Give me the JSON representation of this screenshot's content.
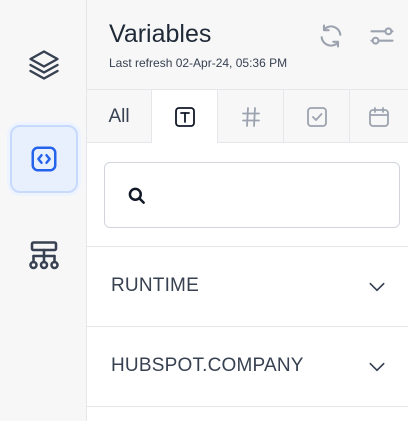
{
  "sidebar": {
    "items": [
      {
        "icon": "layers-icon",
        "active": false
      },
      {
        "icon": "code-brackets-icon",
        "active": true
      },
      {
        "icon": "flow-tree-icon",
        "active": false
      }
    ]
  },
  "header": {
    "title": "Variables",
    "subtitle": "Last refresh 02-Apr-24, 05:36 PM",
    "icons": [
      "refresh-icon",
      "filter-sliders-icon"
    ]
  },
  "tabs": {
    "all_label": "All",
    "items": [
      "text-type-icon",
      "number-hash-icon",
      "checkbox-icon",
      "calendar-icon"
    ],
    "active_index": 1
  },
  "search": {
    "placeholder": "",
    "value": ""
  },
  "sections": [
    {
      "label": "RUNTIME",
      "icon": "chevron-down-icon"
    },
    {
      "label": "HUBSPOT.COMPANY",
      "icon": "chevron-down-icon"
    }
  ],
  "colors": {
    "accent": "#2563eb",
    "icon": "#374151",
    "muted": "#9ca3af"
  }
}
